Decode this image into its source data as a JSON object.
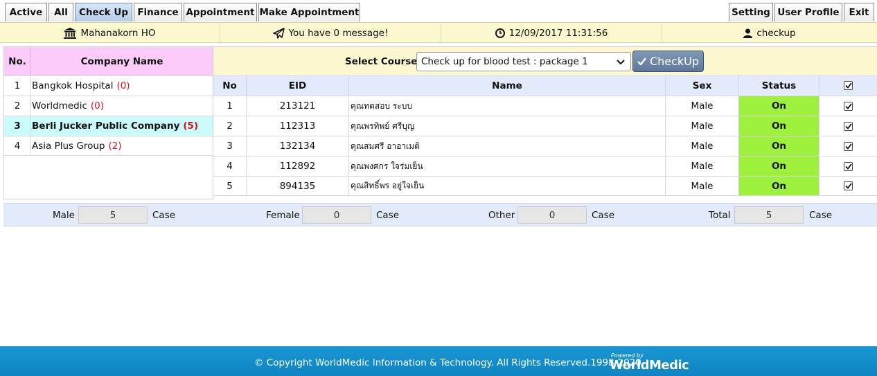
{
  "nav": {
    "left_tabs": [
      {
        "label": "Active",
        "active": false
      },
      {
        "label": "All",
        "active": false
      },
      {
        "label": "Check Up",
        "active": true
      },
      {
        "label": "Finance",
        "active": false
      },
      {
        "label": "Appointment",
        "active": false
      },
      {
        "label": "Make Appointment",
        "active": false
      }
    ],
    "right_tabs": [
      {
        "label": "Setting"
      },
      {
        "label": "User Profile"
      },
      {
        "label": "Exit"
      }
    ]
  },
  "infobar": {
    "branch": "Mahanakorn HO",
    "messages": "You have 0 message!",
    "datetime": "12/09/2017 11:31:56",
    "user": "checkup"
  },
  "companies": {
    "headers": {
      "no": "No.",
      "name": "Company Name"
    },
    "rows": [
      {
        "no": "1",
        "name": "Bangkok Hospital",
        "count": "(0)",
        "selected": false
      },
      {
        "no": "2",
        "name": "Worldmedic",
        "count": "(0)",
        "selected": false
      },
      {
        "no": "3",
        "name": "Berli Jucker Public Company",
        "count": "(5)",
        "selected": true
      },
      {
        "no": "4",
        "name": "Asia Plus Group",
        "count": "(2)",
        "selected": false
      }
    ]
  },
  "course": {
    "label": "Select Course :",
    "selected": "Check up for blood test : package 1",
    "button": "CheckUp"
  },
  "patients": {
    "headers": {
      "no": "No",
      "eid": "EID",
      "name": "Name",
      "sex": "Sex",
      "status": "Status"
    },
    "rows": [
      {
        "no": "1",
        "eid": "213121",
        "name": "คุณทดสอบ ระบบ",
        "sex": "Male",
        "status": "On",
        "checked": true
      },
      {
        "no": "2",
        "eid": "112313",
        "name": "คุณพรทิพย์ ศรีบุญ",
        "sex": "Male",
        "status": "On",
        "checked": true
      },
      {
        "no": "3",
        "eid": "132134",
        "name": "คุณสมศรี อาอาเมติ",
        "sex": "Male",
        "status": "On",
        "checked": true
      },
      {
        "no": "4",
        "eid": "112892",
        "name": "คุณพงศกร ใจร่มเย็น",
        "sex": "Male",
        "status": "On",
        "checked": true
      },
      {
        "no": "5",
        "eid": "894135",
        "name": "คุณสิทธิ์พร อยู่ใจเย็น",
        "sex": "Male",
        "status": "On",
        "checked": true
      }
    ]
  },
  "summary": {
    "male_label": "Male",
    "male": "5",
    "female_label": "Female",
    "female": "0",
    "other_label": "Other",
    "other": "0",
    "total_label": "Total",
    "total": "5",
    "unit": "Case"
  },
  "footer": {
    "copyright": "© Copyright WorldMedic Information & Technology. All Rights Reserved.1998-2020",
    "powered": "Powered by",
    "brand": "WorldMedic"
  },
  "colors": {
    "info_bg": "#fbf8cf",
    "company_header": "#fbcbfa",
    "selected_row": "#ccfbfb",
    "status_on": "#9df13c",
    "footer": "#1996d3",
    "count_red": "#d4101a"
  }
}
